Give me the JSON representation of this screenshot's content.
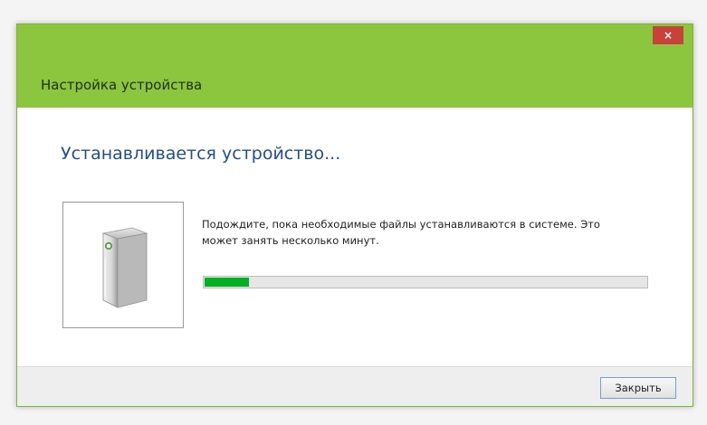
{
  "window": {
    "title": "Настройка устройства",
    "close_glyph": "×",
    "accent_color": "#8cc63f",
    "close_color": "#c8413a"
  },
  "main": {
    "heading": "Устанавливается устройство...",
    "message": "Подождите, пока необходимые файлы устанавливаются в системе. Это может занять несколько минут.",
    "device_icon": "device-tower-icon",
    "progress": {
      "value": 0.1,
      "fill_color": "#06b025"
    }
  },
  "footer": {
    "close_label": "Закрыть"
  }
}
